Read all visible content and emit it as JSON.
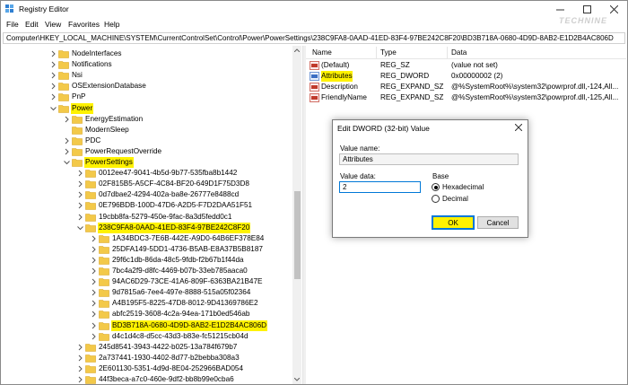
{
  "window": {
    "title": "Registry Editor",
    "watermark": "TECHNINE"
  },
  "menu": [
    "File",
    "Edit",
    "View",
    "Favorites",
    "Help"
  ],
  "address": "Computer\\HKEY_LOCAL_MACHINE\\SYSTEM\\CurrentControlSet\\Control\\Power\\PowerSettings\\238C9FA8-0AAD-41ED-83F4-97BE242C8F20\\BD3B718A-0680-4D9D-8AB2-E1D2B4AC806D",
  "tree": [
    {
      "label": "NodeInterfaces",
      "level": 0,
      "chev": "right",
      "state": ""
    },
    {
      "label": "Notifications",
      "level": 0,
      "chev": "right",
      "state": ""
    },
    {
      "label": "Nsi",
      "level": 0,
      "chev": "right",
      "state": ""
    },
    {
      "label": "OSExtensionDatabase",
      "level": 0,
      "chev": "right",
      "state": ""
    },
    {
      "label": "PnP",
      "level": 0,
      "chev": "right",
      "state": ""
    },
    {
      "label": "Power",
      "level": 0,
      "chev": "down",
      "state": "hl"
    },
    {
      "label": "EnergyEstimation",
      "level": 1,
      "chev": "right",
      "state": ""
    },
    {
      "label": "ModernSleep",
      "level": 1,
      "chev": "",
      "state": ""
    },
    {
      "label": "PDC",
      "level": 1,
      "chev": "right",
      "state": ""
    },
    {
      "label": "PowerRequestOverride",
      "level": 1,
      "chev": "right",
      "state": ""
    },
    {
      "label": "PowerSettings",
      "level": 1,
      "chev": "down",
      "state": "hl"
    },
    {
      "label": "0012ee47-9041-4b5d-9b77-535fba8b1442",
      "level": 2,
      "chev": "right",
      "state": ""
    },
    {
      "label": "02F815B5-A5CF-4C84-BF20-649D1F75D3D8",
      "level": 2,
      "chev": "right",
      "state": ""
    },
    {
      "label": "0d7dbae2-4294-402a-ba8e-26777e8488cd",
      "level": 2,
      "chev": "right",
      "state": ""
    },
    {
      "label": "0E796BDB-100D-47D6-A2D5-F7D2DAA51F51",
      "level": 2,
      "chev": "right",
      "state": ""
    },
    {
      "label": "19cbb8fa-5279-450e-9fac-8a3d5fedd0c1",
      "level": 2,
      "chev": "right",
      "state": ""
    },
    {
      "label": "238C9FA8-0AAD-41ED-83F4-97BE242C8F20",
      "level": 2,
      "chev": "down",
      "state": "hl"
    },
    {
      "label": "1A34BDC3-7E6B-442E-A9D0-64B6EF378E84",
      "level": 3,
      "chev": "right",
      "state": ""
    },
    {
      "label": "25DFA149-5DD1-4736-B5AB-E8A37B5B8187",
      "level": 3,
      "chev": "right",
      "state": ""
    },
    {
      "label": "29f6c1db-86da-48c5-9fdb-f2b67b1f44da",
      "level": 3,
      "chev": "right",
      "state": ""
    },
    {
      "label": "7bc4a2f9-d8fc-4469-b07b-33eb785aaca0",
      "level": 3,
      "chev": "right",
      "state": ""
    },
    {
      "label": "94AC6D29-73CE-41A6-809F-6363BA21B47E",
      "level": 3,
      "chev": "right",
      "state": ""
    },
    {
      "label": "9d7815a6-7ee4-497e-8888-515a05f02364",
      "level": 3,
      "chev": "right",
      "state": ""
    },
    {
      "label": "A4B195F5-8225-47D8-8012-9D41369786E2",
      "level": 3,
      "chev": "right",
      "state": ""
    },
    {
      "label": "abfc2519-3608-4c2a-94ea-171b0ed546ab",
      "level": 3,
      "chev": "right",
      "state": ""
    },
    {
      "label": "BD3B718A-0680-4D9D-8AB2-E1D2B4AC806D",
      "level": 3,
      "chev": "right",
      "state": "hl"
    },
    {
      "label": "d4c1d4c8-d5cc-43d3-b83e-fc51215cb04d",
      "level": 3,
      "chev": "right",
      "state": ""
    },
    {
      "label": "245d8541-3943-4422-b025-13a784f679b7",
      "level": 2,
      "chev": "right",
      "state": ""
    },
    {
      "label": "2a737441-1930-4402-8d77-b2bebba308a3",
      "level": 2,
      "chev": "right",
      "state": ""
    },
    {
      "label": "2E601130-5351-4d9d-8E04-252966BAD054",
      "level": 2,
      "chev": "right",
      "state": ""
    },
    {
      "label": "44f3beca-a7c0-460e-9df2-bb8b99e0cba6",
      "level": 2,
      "chev": "right",
      "state": ""
    },
    {
      "label": "48672F38-7A9A-4bb2-8BF8-3D85BE19DE4E",
      "level": 2,
      "chev": "right",
      "state": ""
    }
  ],
  "list": {
    "columns": [
      "Name",
      "Type",
      "Data"
    ],
    "rows": [
      {
        "icon": "string-value-icon",
        "name": "(Default)",
        "type": "REG_SZ",
        "data": "(value not set)",
        "hl": false
      },
      {
        "icon": "binary-value-icon",
        "name": "Attributes",
        "type": "REG_DWORD",
        "data": "0x00000002 (2)",
        "hl": true
      },
      {
        "icon": "string-value-icon",
        "name": "Description",
        "type": "REG_EXPAND_SZ",
        "data": "@%SystemRoot%\\system32\\powrprof.dll,-124,All...",
        "hl": false
      },
      {
        "icon": "string-value-icon",
        "name": "FriendlyName",
        "type": "REG_EXPAND_SZ",
        "data": "@%SystemRoot%\\system32\\powrprof.dll,-125,All...",
        "hl": false
      }
    ]
  },
  "dialog": {
    "title": "Edit DWORD (32-bit) Value",
    "value_name_label": "Value name:",
    "value_name": "Attributes",
    "value_data_label": "Value data:",
    "value_data": "2",
    "base_label": "Base",
    "radio_hex": "Hexadecimal",
    "radio_dec": "Decimal",
    "selected_base": "hex",
    "ok_label": "OK",
    "cancel_label": "Cancel"
  },
  "colors": {
    "highlight": "#fff200",
    "folder": "#f3c949",
    "accent": "#0078d7"
  }
}
